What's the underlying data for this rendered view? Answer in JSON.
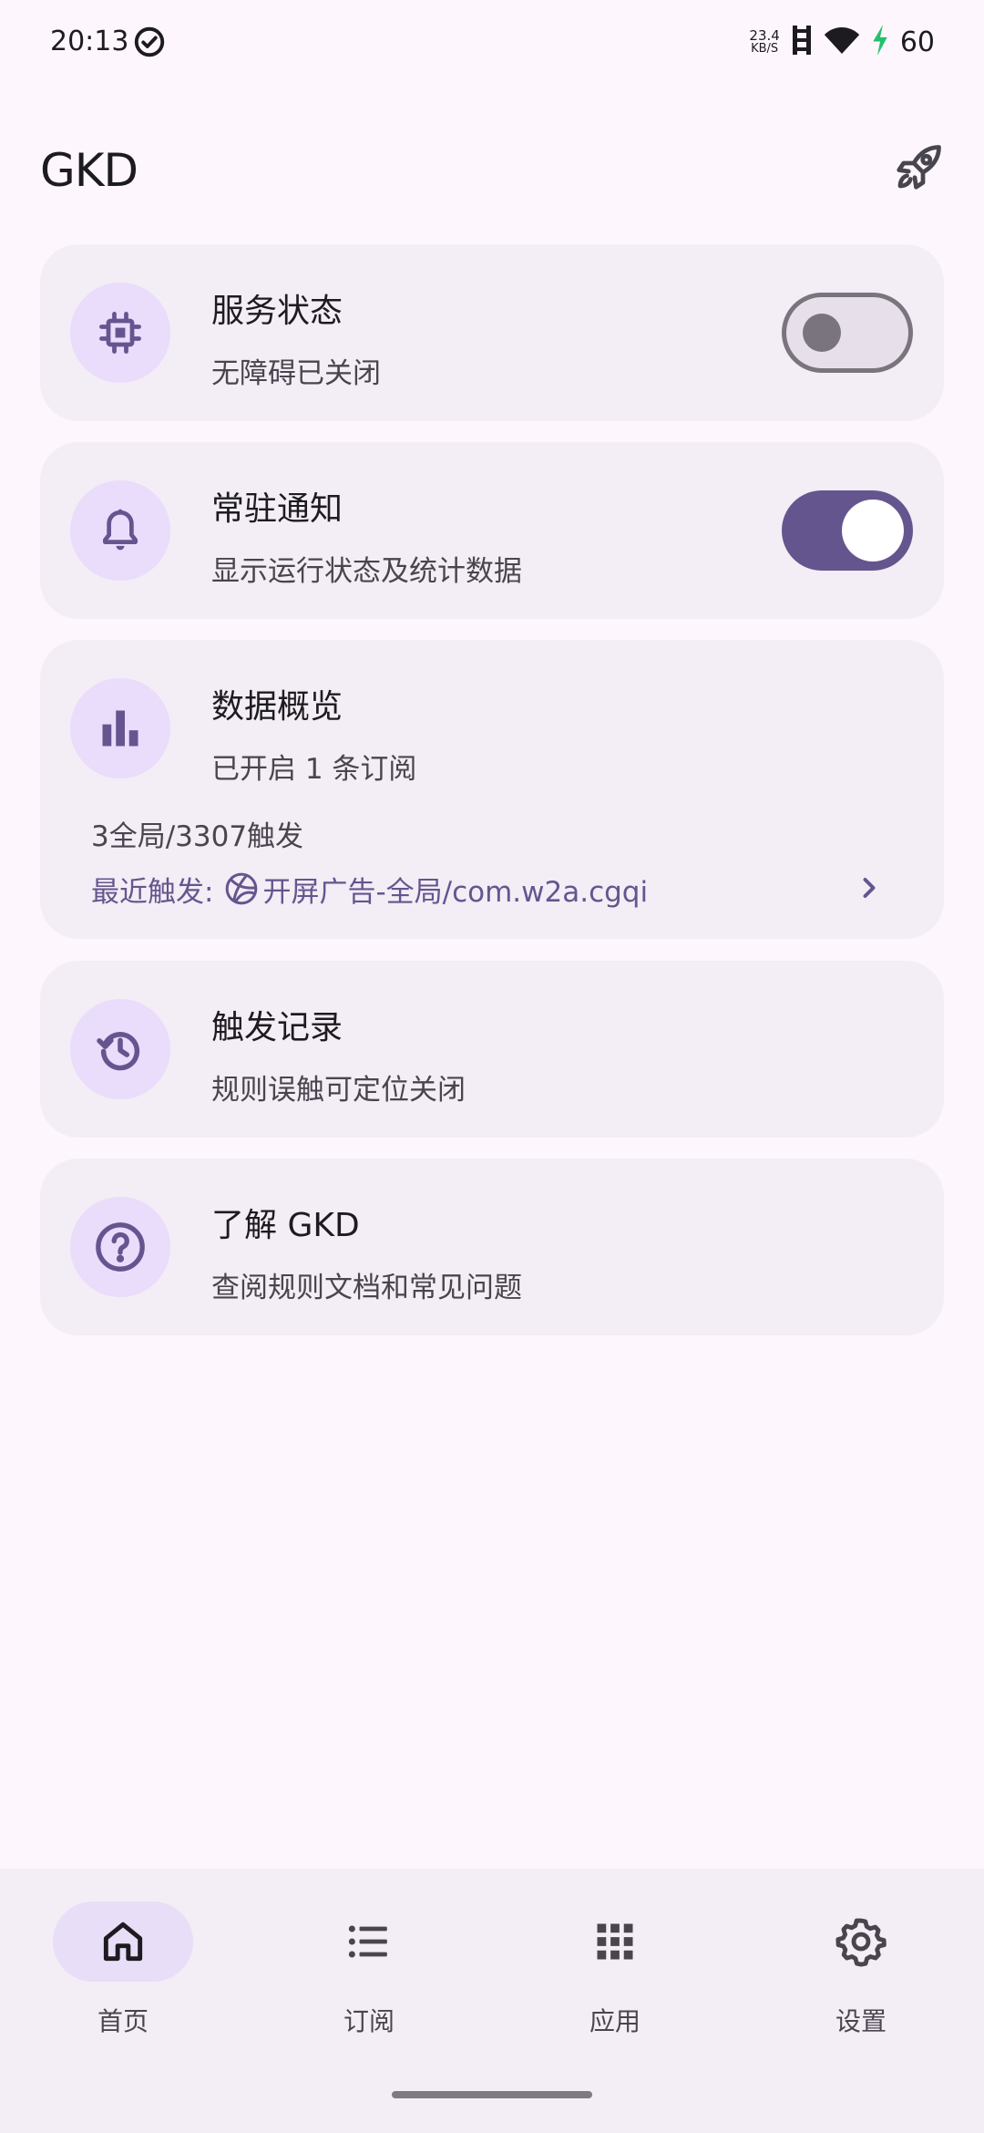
{
  "status_bar": {
    "time": "20:13",
    "net_speed_value": "23.4",
    "net_speed_unit": "KB/S",
    "battery": "60"
  },
  "header": {
    "title": "GKD",
    "rocket_icon": "rocket-icon"
  },
  "cards": {
    "service": {
      "title": "服务状态",
      "subtitle": "无障碍已关闭",
      "icon": "chip-icon",
      "switch_on": false
    },
    "notification": {
      "title": "常驻通知",
      "subtitle": "显示运行状态及统计数据",
      "icon": "bell-icon",
      "switch_on": true
    },
    "overview": {
      "title": "数据概览",
      "subtitle": "已开启 1 条订阅",
      "icon": "bar-chart-icon",
      "stats": "3全局/3307触发",
      "recent_prefix": "最近触发:",
      "recent_value": "开屏广告-全局/com.w2a.cgqi"
    },
    "records": {
      "title": "触发记录",
      "subtitle": "规则误触可定位关闭",
      "icon": "history-icon"
    },
    "about": {
      "title": "了解 GKD",
      "subtitle": "查阅规则文档和常见问题",
      "icon": "help-circle-icon"
    }
  },
  "nav": {
    "items": [
      {
        "label": "首页",
        "icon": "home-icon",
        "active": true
      },
      {
        "label": "订阅",
        "icon": "list-icon",
        "active": false
      },
      {
        "label": "应用",
        "icon": "apps-grid-icon",
        "active": false
      },
      {
        "label": "设置",
        "icon": "settings-gear-icon",
        "active": false
      }
    ]
  },
  "colors": {
    "background": "#fdf7fd",
    "card": "#f3edf5",
    "accent": "#65558f",
    "icon_circle": "#eadcfb",
    "charging": "#22c06b"
  }
}
